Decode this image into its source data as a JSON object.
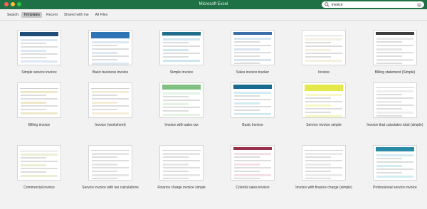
{
  "app": {
    "title": "Microsoft Excel"
  },
  "search": {
    "value": "invoice",
    "placeholder": "Search"
  },
  "filter": {
    "label": "Search:",
    "tabs": [
      "Templates",
      "Recent",
      "Shared with me",
      "All Files"
    ],
    "active": 0
  },
  "colors": {
    "accent": "#1e7145",
    "titlebar": "#1e7145"
  },
  "templates": [
    {
      "name": "Simple service invoice",
      "style": "service"
    },
    {
      "name": "Basic business invoice",
      "style": "business"
    },
    {
      "name": "Simple invoice",
      "style": "simple"
    },
    {
      "name": "Sales invoice tracker",
      "style": "tracker"
    },
    {
      "name": "Invoice",
      "style": "plain"
    },
    {
      "name": "Billing statement (Simple)",
      "style": "statement"
    },
    {
      "name": "Billing invoice",
      "style": "billing"
    },
    {
      "name": "Invoice (worksheet)",
      "style": "worksheet"
    },
    {
      "name": "Invoice with sales tax",
      "style": "salestax"
    },
    {
      "name": "Basic Invoice",
      "style": "basic"
    },
    {
      "name": "Service invoice simple",
      "style": "yellow"
    },
    {
      "name": "Invoice that calculates total (simple)",
      "style": "total"
    },
    {
      "name": "Commercial invoice",
      "style": "commercial"
    },
    {
      "name": "Service invoice with tax calculations",
      "style": "taxcalc"
    },
    {
      "name": "Finance charge invoice simple",
      "style": "finance"
    },
    {
      "name": "Colorful sales invoice",
      "style": "colorful"
    },
    {
      "name": "Invoice with finance charge (simple)",
      "style": "financeb"
    },
    {
      "name": "Professional service invoice",
      "style": "professional"
    }
  ]
}
